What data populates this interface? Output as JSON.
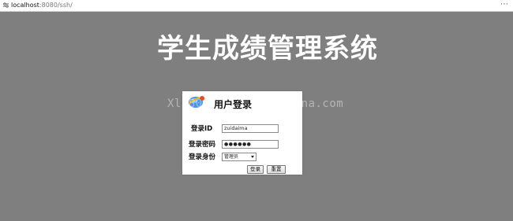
{
  "browser": {
    "address_host": "localhost",
    "address_rest": ":8080/ssh/",
    "more_icon": "ellipsis-icon"
  },
  "page": {
    "title": "学生成绩管理系统"
  },
  "login": {
    "title": "用户登录",
    "id_label": "登录ID",
    "id_value": "zuidaima",
    "password_label": "登录密码",
    "password_masked": "●●●●●●",
    "role_label": "登录身份",
    "role_selected": "管理员",
    "login_button": "登录",
    "reset_button": "重置"
  },
  "watermark": {
    "text": "Xl1800........uidaina.com"
  },
  "colors": {
    "background": "#7f7f7f",
    "panel": "#ffffff"
  }
}
